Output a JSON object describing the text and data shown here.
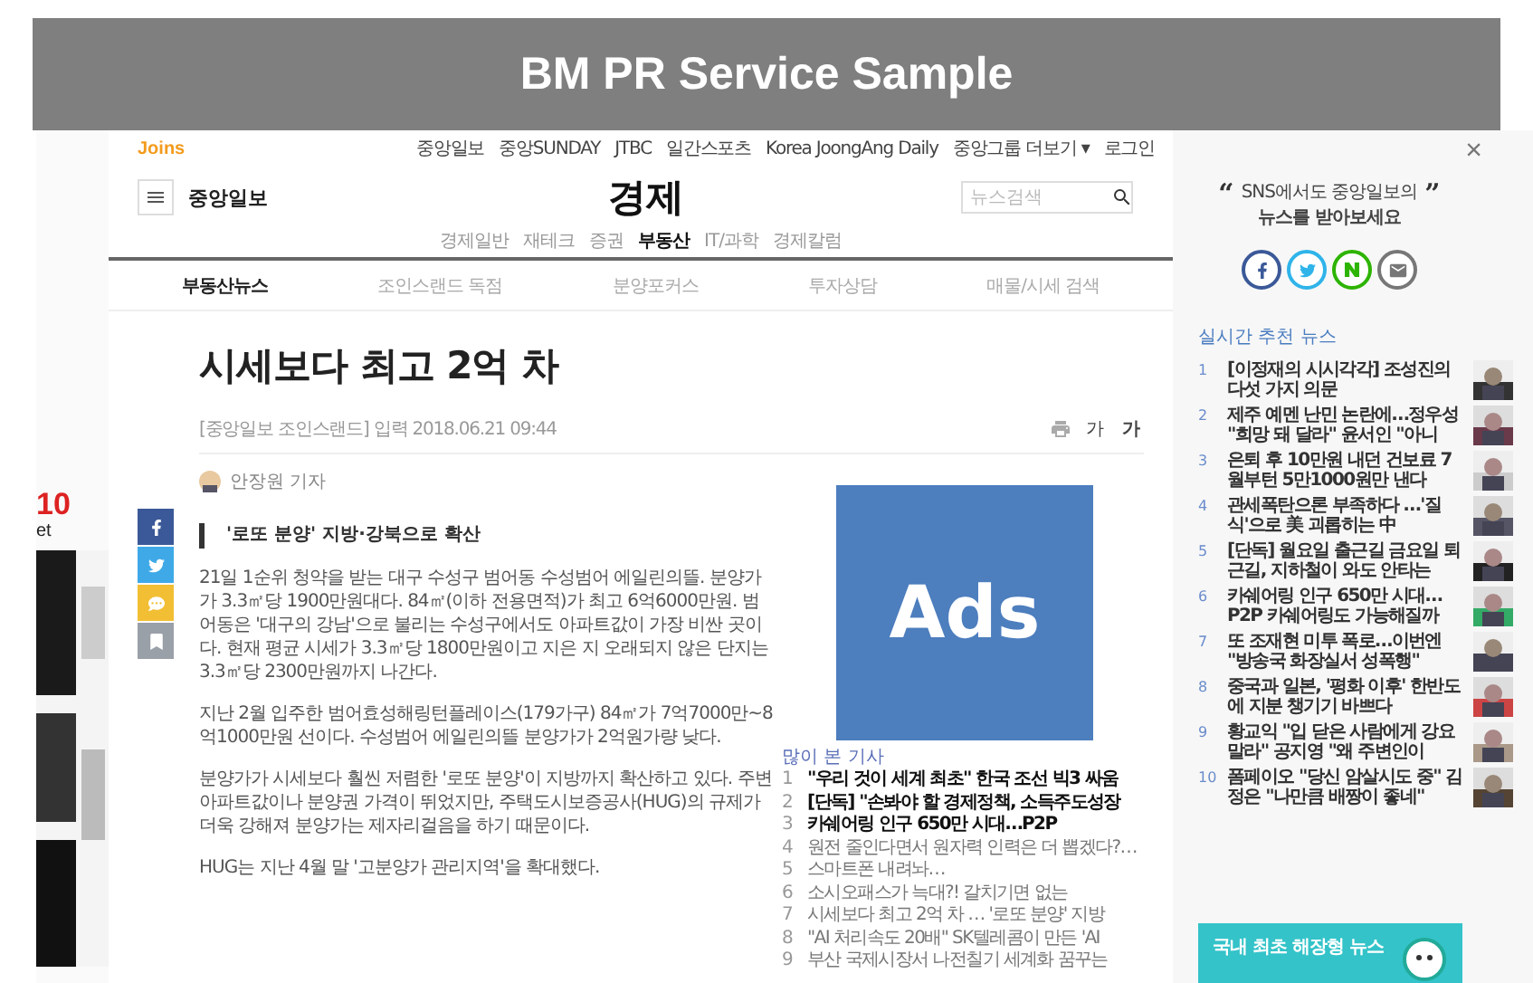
{
  "banner": {
    "title": "BM PR Service Sample"
  },
  "left_ad": {
    "texts": [
      "10",
      "et"
    ]
  },
  "util_bar": {
    "logo": "Joins",
    "links": [
      "중앙일보",
      "중앙SUNDAY",
      "JTBC",
      "일간스포츠",
      "Korea JoongAng Daily",
      "중앙그룹 더보기 ▾",
      "로그인"
    ]
  },
  "masthead": {
    "brand": "중앙일보",
    "section": "경제",
    "search": {
      "placeholder": "뉴스검색"
    }
  },
  "categories": [
    {
      "label": "경제일반",
      "selected": false
    },
    {
      "label": "재테크",
      "selected": false
    },
    {
      "label": "증권",
      "selected": false
    },
    {
      "label": "부동산",
      "selected": true
    },
    {
      "label": "IT/과학",
      "selected": false
    },
    {
      "label": "경제칼럼",
      "selected": false
    }
  ],
  "section_nav": [
    {
      "label": "부동산뉴스",
      "selected": true
    },
    {
      "label": "조인스랜드 독점",
      "selected": false
    },
    {
      "label": "분양포커스",
      "selected": false
    },
    {
      "label": "투자상담",
      "selected": false
    },
    {
      "label": "매물/시세 검색",
      "selected": false
    }
  ],
  "article": {
    "title": "시세보다 최고 2억 차",
    "meta": "[중앙일보 조인스랜드] 입력 2018.06.21 09:44",
    "font_buttons": [
      "가",
      "가"
    ],
    "reporter": "안장원 기자",
    "share": [
      {
        "kind": "facebook"
      },
      {
        "kind": "twitter"
      },
      {
        "kind": "kakao"
      },
      {
        "kind": "save"
      }
    ],
    "subhead": "'로또 분양' 지방·강북으로 확산",
    "paragraphs": [
      "21일 1순위 청약을 받는 대구 수성구 범어동 수성범어 에일린의뜰. 분양가가 3.3㎡당 1900만원대다. 84㎡(이하 전용면적)가 최고 6억6000만원. 범어동은 '대구의 강남'으로 불리는 수성구에서도 아파트값이 가장 비싼 곳이다. 현재 평균 시세가 3.3㎡당 1800만원이고 지은 지 오래되지 않은 단지는 3.3㎡당 2300만원까지 나간다.",
      "지난 2월 입주한 범어효성해링턴플레이스(179가구) 84㎡가 7억7000만~8억1000만원 선이다. 수성범어 에일린의뜰 분양가가 2억원가량 낮다.",
      "분양가가 시세보다 훨씬 저렴한 '로또 분양'이 지방까지 확산하고 있다. 주변 아파트값이나 분양권 가격이 뛰었지만, 주택도시보증공사(HUG)의 규제가 더욱 강해져 분양가는 제자리걸음을 하기 때문이다.",
      "HUG는 지난 4월 말 '고분양가 관리지역'을 확대했다."
    ]
  },
  "ad": {
    "label": "Ads"
  },
  "most_viewed": {
    "title": "많이 본 기사",
    "items": [
      {
        "rank": "1",
        "title": "\"우리 것이 세계 최초\" 한국 조선 빅3 싸움",
        "highlighted": true
      },
      {
        "rank": "2",
        "title": "[단독] \"손봐야 할 경제정책, 소득주도성장",
        "highlighted": true
      },
      {
        "rank": "3",
        "title": "카쉐어링 인구 650만 시대…P2P",
        "highlighted": true
      },
      {
        "rank": "4",
        "title": "원전 줄인다면서 원자력 인력은 더 뽑겠다?…",
        "highlighted": false
      },
      {
        "rank": "5",
        "title": "스마트폰 내려놔…",
        "highlighted": false
      },
      {
        "rank": "6",
        "title": "소시오패스가 늑대?! 갈치기면 없는",
        "highlighted": false
      },
      {
        "rank": "7",
        "title": "시세보다 최고 2억 차 … '로또 분양' 지방",
        "highlighted": false
      },
      {
        "rank": "8",
        "title": "\"AI 처리속도 20배\" SK텔레콤이 만든 'AI",
        "highlighted": false
      },
      {
        "rank": "9",
        "title": "부산 국제시장서 나전칠기 세계화 꿈꾸는",
        "highlighted": false
      }
    ]
  },
  "side_panel": {
    "close": "×",
    "quote_open": "“",
    "quote_close": "”",
    "promo_lines": [
      "SNS에서도 중앙일보의",
      "뉴스를 받아보세요"
    ],
    "social": [
      {
        "kind": "facebook"
      },
      {
        "kind": "twitter"
      },
      {
        "kind": "naver"
      },
      {
        "kind": "mail"
      }
    ],
    "recommend_title": "실시간 추천 뉴스",
    "recommend": [
      {
        "rank": "1",
        "title": "[이정재의 시시각각] 조성진의 다섯 가지 의문"
      },
      {
        "rank": "2",
        "title": "제주 예멘 난민 논란에…정우성 \"희망 돼 달라\" 윤서인 \"아니"
      },
      {
        "rank": "3",
        "title": "은퇴 후 10만원 내던 건보료 7월부턴 5만1000원만 낸다"
      },
      {
        "rank": "4",
        "title": "관세폭탄으론 부족하다 …'질식'으로 美 괴롭히는 中"
      },
      {
        "rank": "5",
        "title": "[단독] 월요일 출근길 금요일 퇴근길, 지하철이 와도 안타는"
      },
      {
        "rank": "6",
        "title": "카쉐어링 인구 650만 시대… P2P 카쉐어링도 가능해질까"
      },
      {
        "rank": "7",
        "title": "또 조재현 미투 폭로…이번엔 \"방송국 화장실서 성폭행\""
      },
      {
        "rank": "8",
        "title": "중국과 일본, '평화 이후' 한반도에 지분 챙기기 바쁘다"
      },
      {
        "rank": "9",
        "title": "황교익 \"입 닫은 사람에게 강요 말라\" 공지영 \"왜 주변인이"
      },
      {
        "rank": "10",
        "title": "폼페이오 \"당신 암살시도 중\" 김정은 \"나만큼 배짱이 좋네\""
      }
    ],
    "promo_banner": "국내 최초 해장형 뉴스"
  }
}
